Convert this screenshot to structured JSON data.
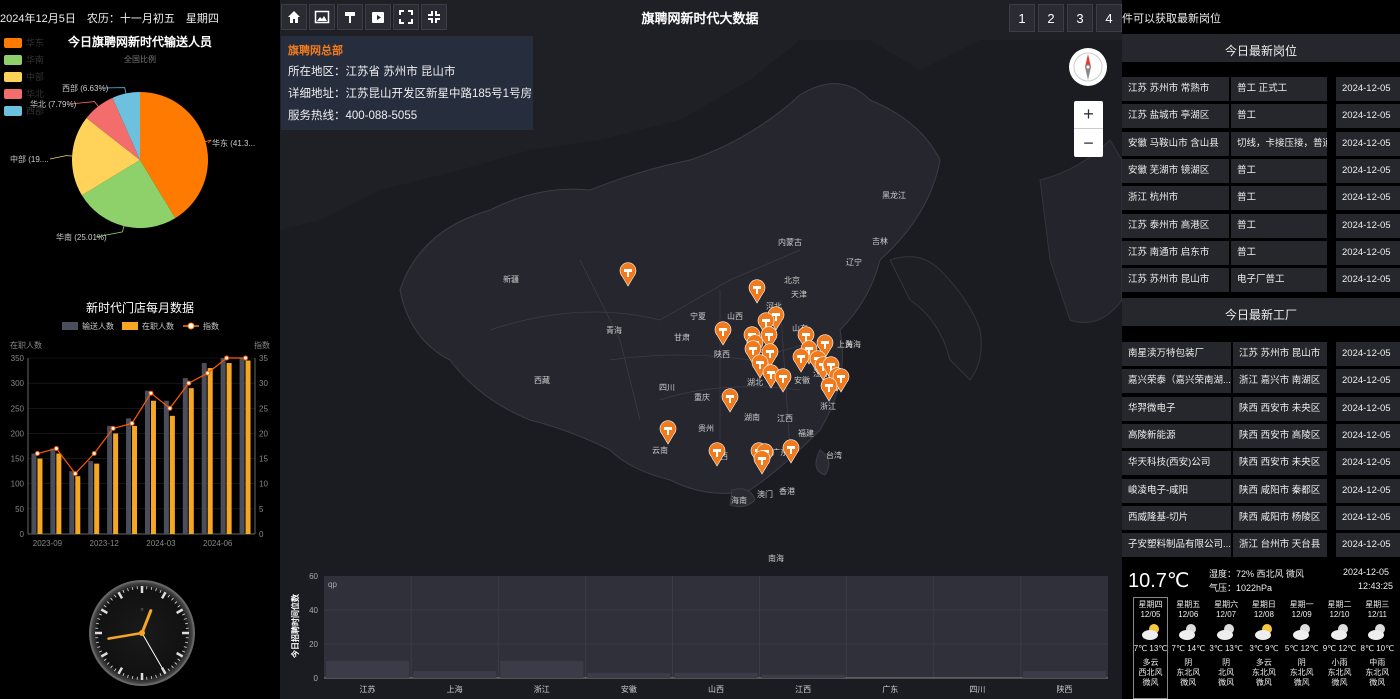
{
  "header": {
    "date_text": "2024年12月5日　农历：十一月初五　星期四",
    "app_title": "旗聘网新时代大数据",
    "page_buttons": [
      "1",
      "2",
      "3",
      "4"
    ],
    "marquee": "件可以获取最新岗位"
  },
  "toolbar": {
    "icons": [
      "home-icon",
      "image-icon",
      "brand-icon",
      "video-icon",
      "fullscreen-icon",
      "collapse-icon"
    ]
  },
  "hq": {
    "title": "旗聘网总部",
    "region": "所在地区：江苏省 苏州市 昆山市",
    "address": "详细地址：江苏昆山开发区新星中路185号1号房",
    "hotline": "服务热线：400-088-5055"
  },
  "pie": {
    "title": "今日旗聘网新时代输送人员",
    "subtitle": "全国比例",
    "legend": [
      "华东",
      "华南",
      "中部",
      "华北",
      "西部"
    ],
    "colors": [
      "#ff7a00",
      "#8ed16b",
      "#ffd35a",
      "#f46d6d",
      "#6ec1de"
    ],
    "labels": [
      "华东 (41.3...",
      "华南 (25.01%)",
      "中部 (19....",
      "华北 (7.79%)",
      "西部 (6.63%)"
    ],
    "values": [
      41.3,
      25.01,
      19.27,
      7.79,
      6.63
    ]
  },
  "monthly": {
    "title": "新时代门店每月数据",
    "legend": [
      "输送人数",
      "在职人数",
      "指数"
    ],
    "left_axis_label": "在职人数",
    "right_axis_label": "指数",
    "left_ticks": [
      "350",
      "300",
      "250",
      "200",
      "150",
      "100",
      "50",
      "0"
    ],
    "right_ticks": [
      "35",
      "30",
      "25",
      "20",
      "15",
      "10",
      "5",
      "0"
    ],
    "x_ticks": [
      "2023-09",
      "2023-12",
      "2024-03",
      "2024-06"
    ],
    "transport": [
      160,
      170,
      125,
      145,
      215,
      230,
      285,
      265,
      310,
      340,
      350,
      350
    ],
    "employed": [
      150,
      160,
      115,
      140,
      200,
      215,
      265,
      235,
      290,
      330,
      340,
      345
    ],
    "index": [
      16,
      17,
      12,
      16,
      21,
      22,
      28,
      25,
      30,
      32,
      35,
      35
    ]
  },
  "bottom_chart": {
    "y_label": "今日招聘时间位数",
    "series_label": "qp",
    "y_ticks": [
      "60",
      "40",
      "20",
      "0"
    ],
    "categories": [
      "江苏",
      "上海",
      "浙江",
      "安徽",
      "山西",
      "江西",
      "广东",
      "四川",
      "陕西"
    ],
    "values": [
      10,
      4,
      10,
      3,
      3,
      2,
      0,
      0,
      4
    ]
  },
  "map": {
    "labels": [
      "黑龙江",
      "吉林",
      "内蒙古",
      "辽宁",
      "北京",
      "天津",
      "河北",
      "山西",
      "山东",
      "宁夏",
      "甘肃",
      "陕西",
      "河南",
      "新疆",
      "青海",
      "西藏",
      "四川",
      "湖北",
      "安徽",
      "江苏",
      "上海",
      "重庆",
      "贵州",
      "湖南",
      "江西",
      "浙江",
      "福建",
      "台湾",
      "云南",
      "广西",
      "广东",
      "澳门",
      "香港",
      "海南",
      "南海",
      "黄海"
    ]
  },
  "jobs": {
    "title": "今日最新岗位",
    "rows": [
      [
        "江苏 苏州市 常熟市",
        "普工 正式工",
        "2024-12-05"
      ],
      [
        "江苏 盐城市 亭湖区",
        "普工",
        "2024-12-05"
      ],
      [
        "安徽 马鞍山市 含山县",
        "切线，卡接压接，普通装配",
        "2024-12-05"
      ],
      [
        "安徽 芜湖市 镜湖区",
        "普工",
        "2024-12-05"
      ],
      [
        "浙江 杭州市",
        "普工",
        "2024-12-05"
      ],
      [
        "江苏 泰州市 高港区",
        "普工",
        "2024-12-05"
      ],
      [
        "江苏 南通市 启东市",
        "普工",
        "2024-12-05"
      ],
      [
        "江苏 苏州市 昆山市",
        "电子厂普工",
        "2024-12-05"
      ]
    ]
  },
  "factories": {
    "title": "今日最新工厂",
    "rows": [
      [
        "南星渎万特包装厂",
        "江苏 苏州市 昆山市",
        "2024-12-05"
      ],
      [
        "嘉兴荣泰（嘉兴荣南湖...",
        "浙江 嘉兴市 南湖区",
        "2024-12-05"
      ],
      [
        "华羿微电子",
        "陕西 西安市 未央区",
        "2024-12-05"
      ],
      [
        "高陵新能源",
        "陕西 西安市 高陵区",
        "2024-12-05"
      ],
      [
        "华天科技(西安)公司",
        "陕西 西安市 未央区",
        "2024-12-05"
      ],
      [
        "峻凌电子-咸阳",
        "陕西 咸阳市 秦都区",
        "2024-12-05"
      ],
      [
        "西威隆基-切片",
        "陕西 咸阳市 杨陵区",
        "2024-12-05"
      ],
      [
        "子安塑料制品有限公司...",
        "浙江 台州市 天台县",
        "2024-12-05"
      ]
    ]
  },
  "weather": {
    "temp": "10.7℃",
    "humidity": "湿度：72% 西北风 微风",
    "pressure": "气压：1022hPa",
    "date": "2024-12-05",
    "time": "12:43:25",
    "days": [
      {
        "name": "星期四",
        "date": "12/05",
        "lo": "7℃",
        "hi": "13℃",
        "cond": "多云",
        "wind": "西北风",
        "level": "微风"
      },
      {
        "name": "星期五",
        "date": "12/06",
        "lo": "7℃",
        "hi": "14℃",
        "cond": "阴",
        "wind": "东北风",
        "level": "微风"
      },
      {
        "name": "星期六",
        "date": "12/07",
        "lo": "3℃",
        "hi": "13℃",
        "cond": "阴",
        "wind": "北风",
        "level": "微风"
      },
      {
        "name": "星期日",
        "date": "12/08",
        "lo": "3℃",
        "hi": "9℃",
        "cond": "多云",
        "wind": "东北风",
        "level": "微风"
      },
      {
        "name": "星期一",
        "date": "12/09",
        "lo": "5℃",
        "hi": "12℃",
        "cond": "阴",
        "wind": "东北风",
        "level": "微风"
      },
      {
        "name": "星期二",
        "date": "12/10",
        "lo": "9℃",
        "hi": "12℃",
        "cond": "小雨",
        "wind": "东北风",
        "level": "微风"
      },
      {
        "name": "星期三",
        "date": "12/11",
        "lo": "8℃",
        "hi": "10℃",
        "cond": "中雨",
        "wind": "东北风",
        "level": "微风"
      }
    ]
  },
  "clock": {
    "hour": 12,
    "minute": 43,
    "second": 25
  }
}
